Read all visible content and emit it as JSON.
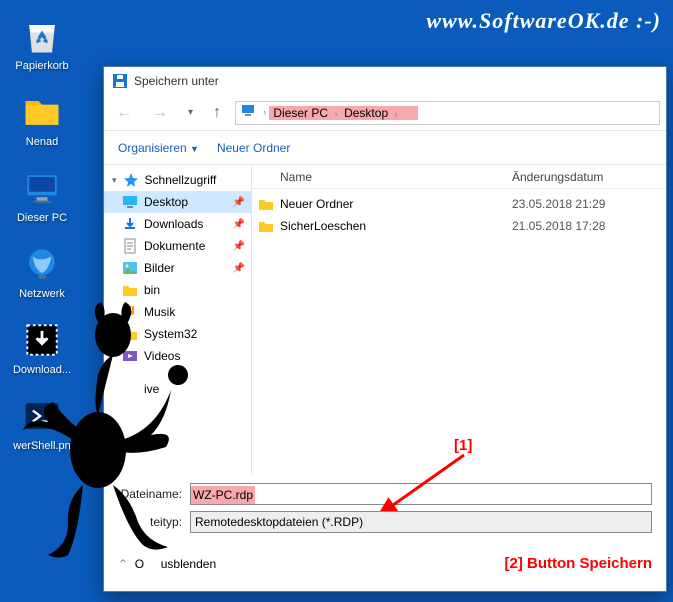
{
  "watermark": "www.SoftwareOK.de :-)",
  "desktop": {
    "items": [
      {
        "label": "Papierkorb"
      },
      {
        "label": "Nenad"
      },
      {
        "label": "Dieser PC"
      },
      {
        "label": "Netzwerk"
      },
      {
        "label": "Download..."
      },
      {
        "label": "werShell.pn"
      }
    ]
  },
  "dialog": {
    "title": "Speichern unter",
    "breadcrumb": {
      "item1": "Dieser PC",
      "item2": "Desktop"
    },
    "toolbar": {
      "organize": "Organisieren",
      "newfolder": "Neuer Ordner"
    },
    "columns": {
      "name": "Name",
      "date": "Änderungsdatum"
    },
    "tree": {
      "root": "Schnellzugriff",
      "items": [
        {
          "label": "Desktop"
        },
        {
          "label": "Downloads"
        },
        {
          "label": "Dokumente"
        },
        {
          "label": "Bilder"
        },
        {
          "label": "bin"
        },
        {
          "label": "Musik"
        },
        {
          "label": "System32"
        },
        {
          "label": "Videos"
        },
        {
          "label": "ive"
        }
      ]
    },
    "files": [
      {
        "name": "Neuer Ordner",
        "date": "23.05.2018 21:29"
      },
      {
        "name": "SicherLoeschen",
        "date": "21.05.2018 17:28"
      }
    ],
    "filenameLabel": "Dateiname:",
    "filenameValue": "WZ-PC.rdp",
    "filetypeLabel": "teityp:",
    "filetypeValue": "Remotedesktopdateien (*.RDP)",
    "hideFolders": "usblenden"
  },
  "annotations": {
    "one": "[1]",
    "two": "[2]   Button Speichern"
  }
}
